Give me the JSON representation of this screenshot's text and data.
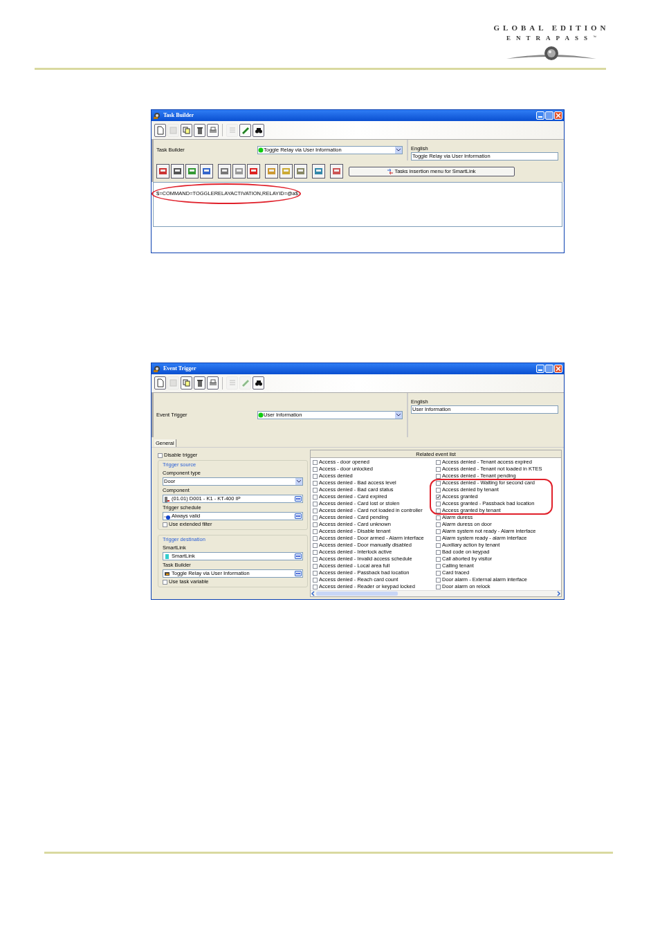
{
  "header": {
    "logo_line_1": "GLOBAL EDITION",
    "logo_line_2": "ENTRAPASS",
    "logo_mark": "™"
  },
  "task_builder_window": {
    "title": "Task Builder",
    "toolbar": [
      {
        "kind": "new",
        "disabled": false
      },
      {
        "kind": "save",
        "disabled": true
      },
      {
        "kind": "copy",
        "disabled": false
      },
      {
        "kind": "delete",
        "disabled": false
      },
      {
        "kind": "print",
        "disabled": false
      },
      {
        "kind": "list",
        "disabled": true
      },
      {
        "kind": "link",
        "disabled": false
      },
      {
        "kind": "find",
        "disabled": false
      }
    ],
    "name_label": "Task Builder",
    "name_value": "Toggle Relay via User Information",
    "language_label": "English",
    "language_value": "Toggle Relay via User Information",
    "insertion_button": "Tasks insertion menu for SmartLink",
    "script_text": "$=COMMAND=TOGGLERELAYACTIVATION,RELAYID=@a$"
  },
  "event_trigger_window": {
    "title": "Event Trigger",
    "toolbar": [
      {
        "kind": "new",
        "disabled": false
      },
      {
        "kind": "save",
        "disabled": true
      },
      {
        "kind": "copy",
        "disabled": false
      },
      {
        "kind": "delete",
        "disabled": false
      },
      {
        "kind": "print",
        "disabled": false
      },
      {
        "kind": "list",
        "disabled": true
      },
      {
        "kind": "link",
        "disabled": true
      },
      {
        "kind": "find",
        "disabled": false
      }
    ],
    "name_label": "Event Trigger",
    "name_value": "User Information",
    "language_label": "English",
    "language_value": "User Information",
    "tabs": [
      {
        "label": "General",
        "selected": true
      }
    ],
    "disable_trigger": {
      "label": "Disable trigger",
      "checked": false
    },
    "trigger_source": {
      "title": "Trigger source",
      "component_type_label": "Component type",
      "component_type_value": "Door",
      "component_label": "Component",
      "component_value": "(01.01) D001 - K1 - KT-400 IP",
      "schedule_label": "Trigger schedule",
      "schedule_value": "Always valid",
      "extended_filter": {
        "label": "Use extended filter",
        "checked": false
      }
    },
    "trigger_destination": {
      "title": "Trigger destination",
      "smartlink_label": "SmartLink",
      "smartlink_value": "SmartLink",
      "task_label": "Task Builder",
      "task_value": "Toggle Relay via User Information",
      "task_variable": {
        "label": "Use task variable",
        "checked": false
      }
    },
    "related_events": {
      "title": "Related event list",
      "columns": [
        [
          {
            "label": "Access - door opened",
            "checked": false
          },
          {
            "label": "Access - door unlocked",
            "checked": false
          },
          {
            "label": "Access denied",
            "checked": false
          },
          {
            "label": "Access denied - Bad access level",
            "checked": false
          },
          {
            "label": "Access denied - Bad card status",
            "checked": false
          },
          {
            "label": "Access denied - Card expired",
            "checked": false
          },
          {
            "label": "Access denied - Card lost or stolen",
            "checked": false
          },
          {
            "label": "Access denied - Card not loaded in controller",
            "checked": false
          },
          {
            "label": "Access denied - Card pending",
            "checked": false
          },
          {
            "label": "Access denied - Card unknown",
            "checked": false
          },
          {
            "label": "Access denied - Disable tenant",
            "checked": false
          },
          {
            "label": "Access denied - Door armed - Alarm interface",
            "checked": false
          },
          {
            "label": "Access denied - Door manually disabled",
            "checked": false
          },
          {
            "label": "Access denied - Interlock active",
            "checked": false
          },
          {
            "label": "Access denied - Invalid access schedule",
            "checked": false
          },
          {
            "label": "Access denied - Local area full",
            "checked": false
          },
          {
            "label": "Access denied - Passback bad location",
            "checked": false
          },
          {
            "label": "Access denied - Reach card count",
            "checked": false
          },
          {
            "label": "Access denied - Reader or keypad locked",
            "checked": false
          }
        ],
        [
          {
            "label": "Access denied - Tenant access expired",
            "checked": false
          },
          {
            "label": "Access denied - Tenant not loaded in KTES",
            "checked": false
          },
          {
            "label": "Access denied - Tenant pending",
            "checked": false
          },
          {
            "label": "Access denied - Waiting for second card",
            "checked": false
          },
          {
            "label": "Access denied by tenant",
            "checked": false
          },
          {
            "label": "Access granted",
            "checked": true
          },
          {
            "label": "Access granted - Passback bad location",
            "checked": false
          },
          {
            "label": "Access granted by tenant",
            "checked": false
          },
          {
            "label": "Alarm duress",
            "checked": false
          },
          {
            "label": "Alarm duress on door",
            "checked": false
          },
          {
            "label": "Alarm system not ready - Alarm interface",
            "checked": false
          },
          {
            "label": "Alarm system ready - alarm interface",
            "checked": false
          },
          {
            "label": "Auxiliary action by tenant",
            "checked": false
          },
          {
            "label": "Bad code on keypad",
            "checked": false
          },
          {
            "label": "Call aborted by visitor",
            "checked": false
          },
          {
            "label": "Calling tenant",
            "checked": false
          },
          {
            "label": "Card traced",
            "checked": false
          },
          {
            "label": "Door alarm - External alarm interface",
            "checked": false
          },
          {
            "label": "Door alarm on relock",
            "checked": false
          }
        ]
      ]
    }
  }
}
